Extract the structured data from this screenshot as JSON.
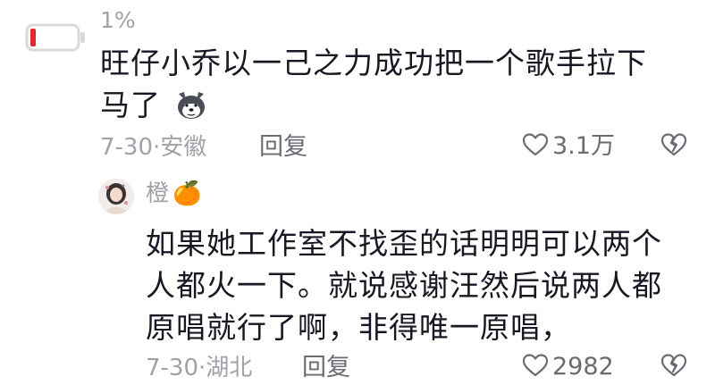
{
  "comment1": {
    "avatar_icon": "battery-low-icon",
    "username": "1%",
    "text_line1": "旺仔小乔以一己之力成功把一个歌手拉下",
    "text_line2": "马了",
    "emoji_icon": "husky-dog-face-icon",
    "date_location": "7-30·安徽",
    "reply_label": "回复",
    "likes": "3.1万",
    "like_icon": "heart-outline-icon",
    "dislike_icon": "broken-heart-icon"
  },
  "reply1": {
    "avatar_icon": "user-avatar-icon",
    "username": "橙",
    "username_emoji": "🍊",
    "text_line1": "如果她工作室不找歪的话明明可以两个",
    "text_line2": "人都火一下。就说感谢汪然后说两人都",
    "text_line3": "原唱就行了啊，非得唯一原唱，",
    "date_location": "7-30·湖北",
    "reply_label": "回复",
    "likes": "2982",
    "like_icon": "heart-outline-icon",
    "dislike_icon": "broken-heart-icon"
  },
  "colors": {
    "battery_red": "#e8242f",
    "text": "#161823",
    "meta": "#a1a2a7",
    "action": "#6b6c72"
  }
}
